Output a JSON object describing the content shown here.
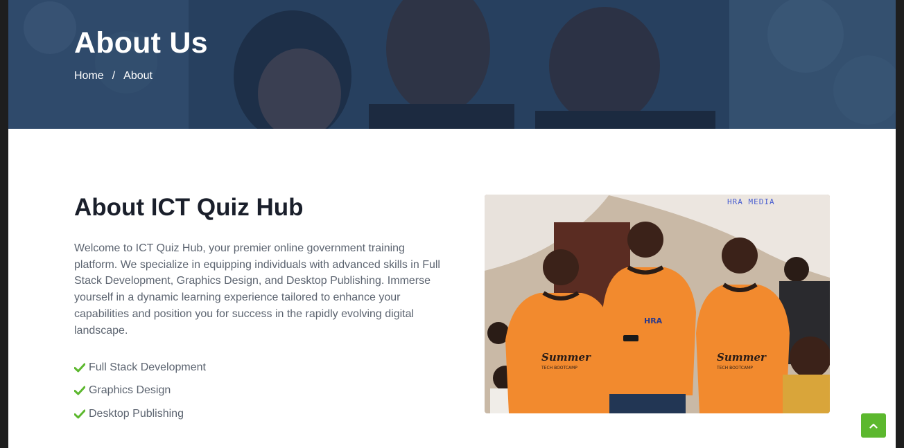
{
  "hero": {
    "title": "About Us",
    "breadcrumb": {
      "home": "Home",
      "separator": "/",
      "current": "About"
    }
  },
  "about": {
    "heading": "About ICT Quiz Hub",
    "description": "Welcome to ICT Quiz Hub, your premier online government training platform. We specialize in equipping individuals with advanced skills in Full Stack Development, Graphics Design, and Desktop Publishing. Immerse yourself in a dynamic learning experience tailored to enhance your capabilities and position you for success in the rapidly evolving digital landscape.",
    "features": [
      "Full Stack Development",
      "Graphics Design",
      "Desktop Publishing"
    ],
    "photo": {
      "watermark": "HRA MEDIA",
      "shirt_text": "Summer",
      "shirt_subtext": "TECH BOOTCAMP",
      "badge_text": "HRA"
    }
  },
  "icons": {
    "feature": "check-icon",
    "back_to_top": "chevron-up-icon"
  },
  "colors": {
    "accent": "#5cb82e",
    "hero_overlay": "#243d5c",
    "heading": "#1a1f2b",
    "body_text": "#5c6470",
    "shirt": "#f28a2e"
  }
}
